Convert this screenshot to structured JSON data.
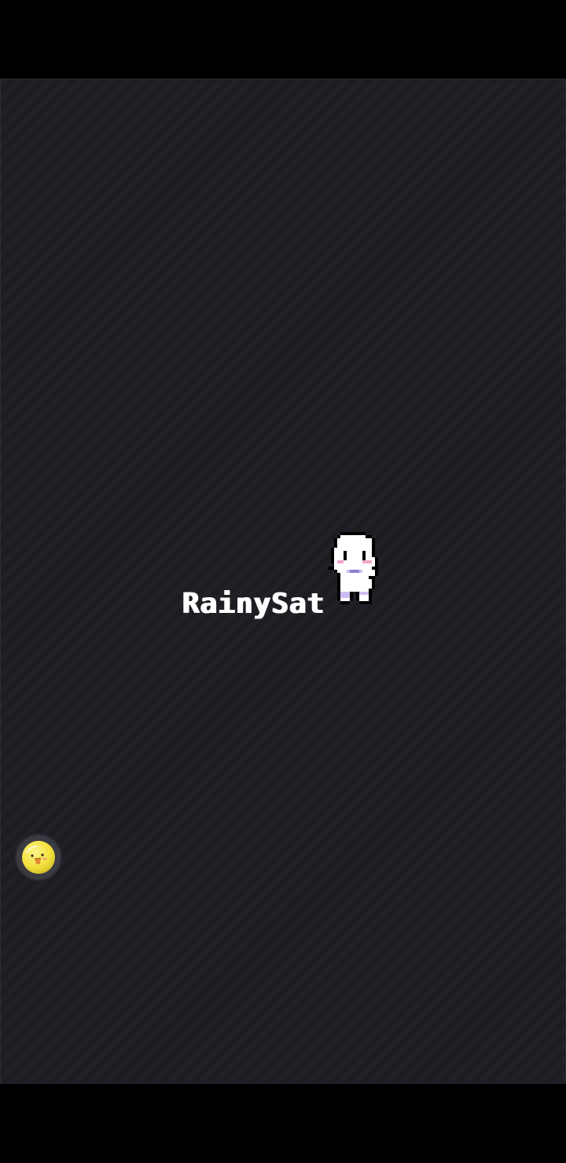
{
  "game": {
    "title": "RainySat"
  },
  "icons": {
    "mascot": "pixel-ghost-character-icon",
    "floating_button": "yellow-duck-avatar-icon"
  },
  "colors": {
    "background": "#1f1f24",
    "title_text": "#ffffff",
    "mascot_body": "#ffffff",
    "mascot_outline": "#000000",
    "mascot_blush": "#f1a7c8",
    "mascot_clothes": "#cdbcf2",
    "avatar_yellow": "#f6e64b"
  }
}
